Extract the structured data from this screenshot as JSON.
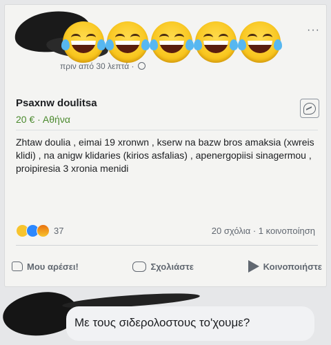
{
  "post": {
    "timestamp": "πριν από 30 λεπτά · ",
    "more": "···",
    "listing_title": "Psaxnw doulitsa",
    "listing_price": "20 € · Αθήνα",
    "body": "Zhtaw doulia , eimai 19 xronwn , kserw na bazw bros amaksia (xwreis klidi) , na anigw klidaries (kirios asfalias) , apenergopiisi sinagermou , proipiresia 3 xronia menidi",
    "reaction_count": "37",
    "comments_shares": "20 σχόλια · 1 κοινοποίηση",
    "actions": {
      "like": "Μου αρέσει!",
      "comment": "Σχολιάστε",
      "share": "Κοινοποιήστε"
    }
  },
  "comment": {
    "text": "Με τους σιδερολοστους το'χουμε?"
  },
  "colors": {
    "price": "#4b8a2e",
    "secondary_text": "#606770",
    "like_blue": "#2d88ff"
  }
}
